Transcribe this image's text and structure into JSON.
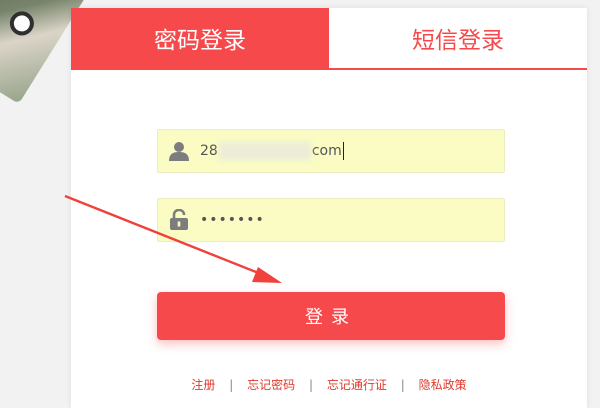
{
  "tabs": {
    "password_login": "密码登录",
    "sms_login": "短信登录"
  },
  "form": {
    "username_prefix": "28",
    "username_suffix": "com",
    "password_masked": "•••••••"
  },
  "buttons": {
    "login": "登录"
  },
  "links": {
    "register": "注册",
    "forgot_password": "忘记密码",
    "forgot_pass_token": "忘记通行证",
    "privacy": "隐私政策"
  },
  "colors": {
    "accent": "#f5494b",
    "input_bg": "#fafcc4",
    "annotation_arrow": "#f0413c"
  },
  "icons": {
    "user_field": "user-icon",
    "password_field": "lock-icon"
  }
}
